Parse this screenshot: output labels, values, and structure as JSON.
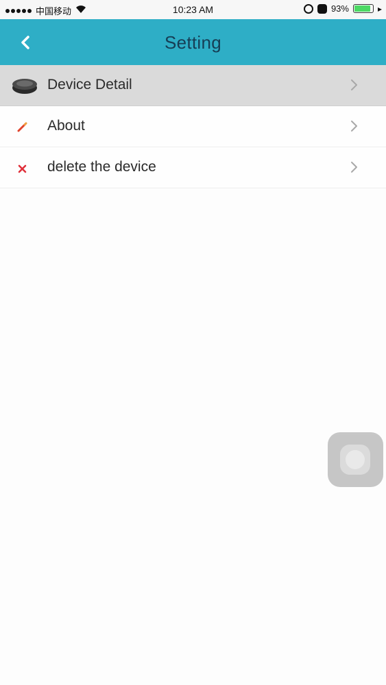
{
  "status_bar": {
    "carrier": "中国移动",
    "time": "10:23 AM",
    "battery_percent": "93%",
    "battery_level": 0.93,
    "battery_color": "#4cd964"
  },
  "nav": {
    "title": "Setting",
    "back_icon": "chevron-left-icon",
    "background": "#2eaec6"
  },
  "menu": [
    {
      "label": "Device Detail",
      "icon": "robot-vacuum-icon"
    },
    {
      "label": "About",
      "icon": "pencil-icon"
    },
    {
      "label": "delete the device",
      "icon": "close-x-icon"
    }
  ],
  "assistive_touch": {
    "icon": "assistive-touch-icon"
  }
}
